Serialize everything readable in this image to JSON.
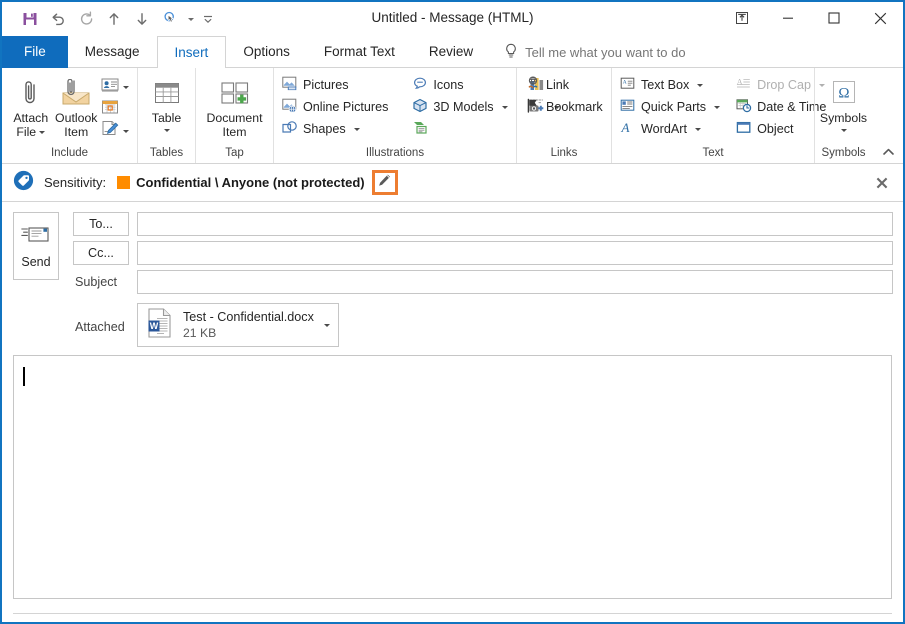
{
  "window": {
    "title": "Untitled  -  Message (HTML)",
    "controls": {
      "restore_up_label": "restore-up",
      "minimize_label": "minimize",
      "maximize_label": "maximize",
      "close_label": "close"
    }
  },
  "quick_access": {
    "items": [
      {
        "name": "save-icon",
        "tooltip": "Save"
      },
      {
        "name": "undo-icon",
        "tooltip": "Undo"
      },
      {
        "name": "redo-icon",
        "tooltip": "Redo"
      },
      {
        "name": "previous-item-icon",
        "tooltip": "Previous Item"
      },
      {
        "name": "next-item-icon",
        "tooltip": "Next Item"
      },
      {
        "name": "touch-mouse-mode-icon",
        "tooltip": "Touch/Mouse Mode"
      }
    ],
    "customize_tooltip": "Customize Quick Access Toolbar"
  },
  "tabs": [
    {
      "label": "File",
      "active": false,
      "kind": "file"
    },
    {
      "label": "Message",
      "active": false,
      "kind": "normal"
    },
    {
      "label": "Insert",
      "active": true,
      "kind": "normal"
    },
    {
      "label": "Options",
      "active": false,
      "kind": "normal"
    },
    {
      "label": "Format Text",
      "active": false,
      "kind": "normal"
    },
    {
      "label": "Review",
      "active": false,
      "kind": "normal"
    }
  ],
  "tellme": {
    "placeholder": "Tell me what you want to do",
    "icon": "lightbulb-icon"
  },
  "ribbon": {
    "groups": [
      {
        "label": "Include",
        "big_buttons": [
          {
            "label_line1": "Attach",
            "label_line2": "File",
            "icon": "paperclip-icon",
            "has_caret": true
          },
          {
            "label_line1": "Outlook",
            "label_line2": "Item",
            "icon": "outlook-item-icon",
            "has_caret": false
          }
        ],
        "mini_buttons": [
          {
            "icon": "business-card-icon",
            "has_caret": true
          },
          {
            "icon": "calendar-icon",
            "has_caret": false
          },
          {
            "icon": "signature-icon",
            "has_caret": true
          }
        ]
      },
      {
        "label": "Tables",
        "big_buttons": [
          {
            "label_line1": "Table",
            "label_line2": "",
            "icon": "table-icon",
            "has_caret": true
          }
        ],
        "mini_buttons": []
      },
      {
        "label": "Tap",
        "big_buttons": [
          {
            "label_line1": "Document",
            "label_line2": "Item",
            "icon": "document-item-icon",
            "has_caret": false
          }
        ],
        "mini_buttons": []
      },
      {
        "label": "Illustrations",
        "small_buttons_col1": [
          {
            "label": "Pictures",
            "icon": "pictures-icon",
            "has_caret": false,
            "disabled": false
          },
          {
            "label": "Online Pictures",
            "icon": "online-pictures-icon",
            "has_caret": false,
            "disabled": false
          },
          {
            "label": "Shapes",
            "icon": "shapes-icon",
            "has_caret": true,
            "disabled": false
          }
        ],
        "small_buttons_col2": [
          {
            "label": "Icons",
            "icon": "icons-icon",
            "has_caret": false,
            "disabled": false
          },
          {
            "label": "3D Models",
            "icon": "3d-models-icon",
            "has_caret": true,
            "disabled": false
          },
          {
            "label": "",
            "icon": "smartart-icon",
            "has_caret": false,
            "disabled": false
          }
        ],
        "small_buttons_col3": [
          {
            "label": "",
            "icon": "chart-icon",
            "has_caret": false,
            "disabled": false
          },
          {
            "label": "",
            "icon": "screenshot-icon",
            "has_caret": true,
            "disabled": false
          }
        ]
      },
      {
        "label": "Links",
        "small_buttons_col1": [
          {
            "label": "Link",
            "icon": "link-icon",
            "has_caret": false,
            "disabled": false
          },
          {
            "label": "Bookmark",
            "icon": "bookmark-icon",
            "has_caret": false,
            "disabled": false
          }
        ]
      },
      {
        "label": "Text",
        "small_buttons_col1": [
          {
            "label": "Text Box",
            "icon": "text-box-icon",
            "has_caret": true,
            "disabled": false
          },
          {
            "label": "Quick Parts",
            "icon": "quick-parts-icon",
            "has_caret": true,
            "disabled": false
          },
          {
            "label": "WordArt",
            "icon": "wordart-icon",
            "has_caret": true,
            "disabled": false
          }
        ],
        "small_buttons_col2": [
          {
            "label": "Drop Cap",
            "icon": "drop-cap-icon",
            "has_caret": true,
            "disabled": true
          },
          {
            "label": "Date & Time",
            "icon": "date-time-icon",
            "has_caret": false,
            "disabled": false
          },
          {
            "label": "Object",
            "icon": "object-icon",
            "has_caret": false,
            "disabled": false
          }
        ]
      },
      {
        "label": "Symbols",
        "big_buttons": [
          {
            "label_line1": "Symbols",
            "label_line2": "",
            "icon": "omega-icon",
            "has_caret": true
          }
        ]
      }
    ],
    "collapse_tooltip": "Collapse the Ribbon"
  },
  "sensitivity_bar": {
    "icon": "sensitivity-tag-icon",
    "label": "Sensitivity:",
    "swatch_color": "#ff8c00",
    "value": "Confidential \\ Anyone (not protected)",
    "edit_icon": "pencil-icon",
    "edit_highlight_color": "#ed7d31",
    "close_icon": "close-icon"
  },
  "compose": {
    "send_label": "Send",
    "send_icon": "send-envelope-icon",
    "to_label": "To...",
    "to_value": "",
    "cc_label": "Cc...",
    "cc_value": "",
    "subject_label": "Subject",
    "subject_value": "",
    "attached_label": "Attached",
    "attachment": {
      "icon": "word-document-icon",
      "name": "Test - Confidential.docx",
      "size": "21 KB",
      "caret_icon": "chevron-down-icon"
    },
    "body_value": ""
  },
  "colors": {
    "window_border": "#1174c0",
    "file_tab": "#0f6cbd",
    "active_tab_text": "#0f6cbd",
    "sensitivity_orange": "#ff8c00",
    "highlight_orange": "#ed7d31",
    "save_purple": "#8a4f9e"
  }
}
